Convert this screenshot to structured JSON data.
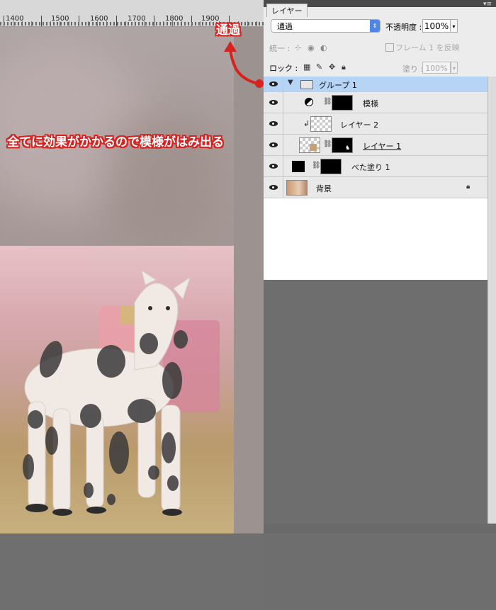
{
  "ruler": {
    "labels": [
      "1400",
      "1500",
      "1600",
      "1700",
      "1800",
      "1900"
    ]
  },
  "panel": {
    "tab_label": "レイヤー",
    "blend_mode": "通過",
    "opacity_label": "不透明度 :",
    "opacity_value": "100%",
    "unify_label": "統一 :",
    "frame_checkbox_label": "フレーム 1 を反映",
    "lock_label": "ロック :",
    "fill_label": "塗り :",
    "fill_value": "100%"
  },
  "layers": [
    {
      "name": "グループ 1",
      "selected": true
    },
    {
      "name": "模様"
    },
    {
      "name": "レイヤー 2"
    },
    {
      "name": "レイヤー 1"
    },
    {
      "name": "べた塗り 1"
    },
    {
      "name": "背景"
    }
  ],
  "annotations": {
    "top": "通過",
    "main": "全てに効果がかかるので模様がはみ出る",
    "color": "#d8221f"
  }
}
